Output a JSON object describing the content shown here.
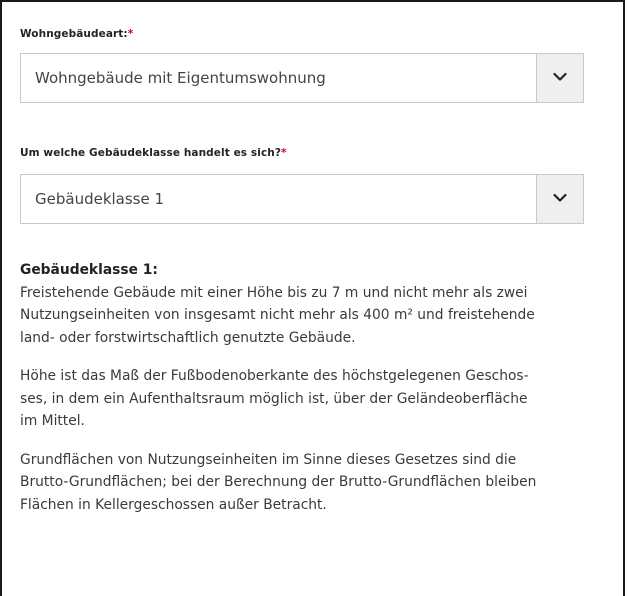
{
  "form": {
    "building_type": {
      "label": "Wohngebäudeart:",
      "required_marker": "*",
      "selected": "Wohngebäude mit Eigentumswohnung"
    },
    "building_class": {
      "label": "Um welche Gebäudeklasse handelt es sich?",
      "required_marker": "*",
      "selected": "Gebäudeklasse 1"
    }
  },
  "info": {
    "title": "Gebäudeklasse 1:",
    "paragraph1": [
      "Freistehende Gebäude mit einer Höhe bis zu 7 m und nicht mehr als zwei",
      "Nutzungseinheiten von insgesamt nicht mehr als 400 m² und freistehende",
      "land- oder forstwirtschaftlich genutzte Gebäude."
    ],
    "paragraph2": [
      "Höhe ist das Maß der Fußbodenoberkante des höchstgelegenen Geschos-",
      "ses, in dem ein Aufenthaltsraum möglich ist, über der Geländeoberfläche",
      "im Mittel."
    ],
    "paragraph3": [
      "Grundflächen von Nutzungseinheiten im Sinne dieses Gesetzes sind die",
      "Brutto-Grundflächen; bei der Berechnung der Brutto-Grundflächen bleiben",
      "Flächen in Kellergeschossen außer Betracht."
    ]
  },
  "icons": {
    "dropdown": "chevron-down-icon"
  },
  "colors": {
    "required": "#d0021b",
    "select_border": "#c8c8c8",
    "select_button_bg": "#efefef",
    "text": "#3a3a3a"
  }
}
